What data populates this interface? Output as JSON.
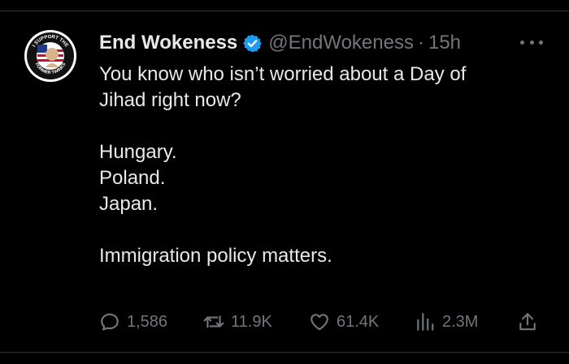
{
  "tweet": {
    "author_name": "End Wokeness",
    "handle": "@EndWokeness",
    "separator": "·",
    "time": "15h",
    "avatar_text": {
      "top": "I SUPPORT THE",
      "bottom": "FORMER TWINKS"
    },
    "text_lines": [
      "You know who isn’t worried about a Day of",
      "Jihad right now?",
      "",
      "Hungary.",
      "Poland.",
      "Japan.",
      "",
      "Immigration policy matters."
    ],
    "metrics": {
      "replies": "1,586",
      "retweets": "11.9K",
      "likes": "61.4K",
      "views": "2.3M"
    }
  },
  "icons": {
    "verified": "verified-badge-icon",
    "more": "more-options-icon",
    "reply": "reply-icon",
    "retweet": "retweet-icon",
    "like": "heart-icon",
    "views": "views-chart-icon",
    "share": "share-icon"
  },
  "colors": {
    "background": "#000000",
    "text": "#e7e9ea",
    "secondary": "#71767b",
    "verified": "#1d9bf0",
    "divider": "#2f3336"
  }
}
